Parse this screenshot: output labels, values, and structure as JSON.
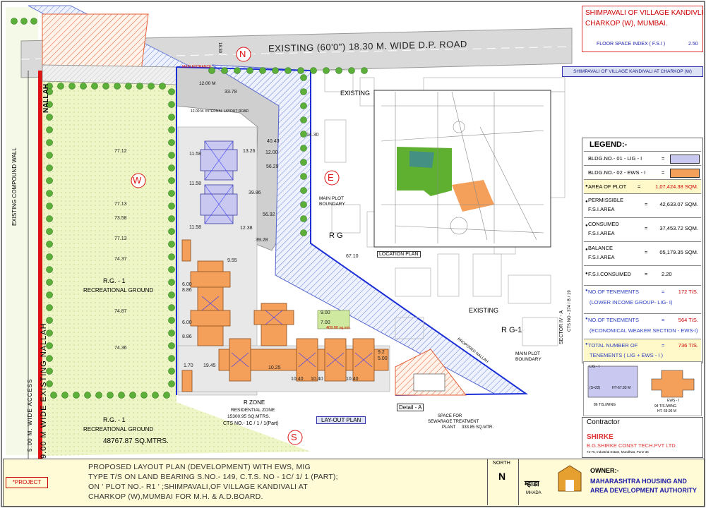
{
  "title_block": {
    "line1": "SHIMPAVALI OF VILLAGE KANDIVLI",
    "line2": "CHARKOP (W), MUMBAI.",
    "fsi_label": "FLOOR SPACE INDEX ( F.S.I )",
    "fsi_value": "2.50"
  },
  "banner_text": "SHIMPAVALI OF VILLAGE KANDIVALI AT CHARKOP (W)",
  "road": {
    "label": "EXISTING (60'0\") 18.30 M. WIDE D.P. ROAD",
    "north_marker": "N",
    "east_marker": "E",
    "west_marker": "W",
    "south_marker": "S"
  },
  "site_labels": {
    "nallah": "NALLAH",
    "compound_wall": "EXISTING COMPOUND WALL",
    "wide_access": "5.00 M. WIDE ACCESS",
    "existing_nallah": "9.00 M WIDE EXISTING NALLAH",
    "rg1_upper": "R.G. - 1",
    "rec_ground_upper": "RECREATIONAL GROUND",
    "rg1_lower": "R.G. - 1",
    "rec_ground_lower": "RECREATIONAL GROUND",
    "rec_ground_area": "48767.87 SQ.MTRS.",
    "main_plot_boundary_1": "MAIN PLOT",
    "main_plot_boundary_2": "BOUNDARY",
    "main_plot_boundary_b1": "MAIN PLOT",
    "main_plot_boundary_b2": "BOUNDARY",
    "rg": "R G",
    "rg1_east": "R G-1",
    "existing_1": "EXISTING",
    "existing_2": "EXISTING",
    "sector": "SECTOR IV - A",
    "cts": "CTS NO - 374 / B / 19",
    "res_zone": "R ZONE",
    "res_zone_title": "RESIDENTIAL ZONE",
    "res_zone_area": "15300.95 SQ.MTRS.",
    "res_zone_cts": "CTS NO.- 1C / 1 / 1(Part)",
    "detail_a": "Detail - A",
    "layout_plan": "LAY-OUT PLAN",
    "stp_1": "SPACE FOR",
    "stp_2": "SEWARAGE TREATMENT",
    "stp_3": "PLANT",
    "stp_area": "333.85 SQ.MTR.",
    "location_plan": "LOCATION PLAN",
    "proposed_nallah": "PROPOSED NALLAH",
    "internal_road": "12.00 M. INTERNAL LAYOUT ROAD",
    "main_entrance": "MAIN ENTRANCE",
    "dim_12": "12.00 M",
    "dim_1830": "18.30",
    "open_space": "409.00 sq.mtr."
  },
  "dimensions": [
    "77.12",
    "77.13",
    "73.58",
    "77.13",
    "74.37",
    "74.87",
    "74.36",
    "40.43",
    "56.29",
    "56.92",
    "67.10",
    "11.58",
    "11.58",
    "11.58",
    "13.26",
    "12.00",
    "39.86",
    "12.38",
    "39.28",
    "9.55",
    "6.00",
    "8.86",
    "6.00",
    "8.86",
    "19.45",
    "10.25",
    "9.00",
    "7.00",
    "9.2",
    "5.00",
    "1.70",
    "10.40",
    "10.40",
    "10.40",
    "14.30",
    "33.78"
  ],
  "legend": {
    "title": "LEGEND:-",
    "bldg1": "BLDG.NO.- 01 - LIG - I",
    "bldg1_color": "#c8c8f0",
    "bldg2": "BLDG.NO.- 02 - EWS - I",
    "bldg2_color": "#f5a05a",
    "eq": "=",
    "area_plot_label": "AREA OF PLOT",
    "area_plot_value": "1,07,424.38 SQM.",
    "permissible_label_1": "PERMISSIBLE",
    "permissible_label_2": "F.S.I.AREA",
    "permissible_value": "42,633.07 SQM.",
    "consumed_label_1": "CONSUMED",
    "consumed_label_2": "F.S.I.AREA",
    "consumed_value": "37,453.72 SQM.",
    "balance_label_1": "BALANCE",
    "balance_label_2": "F.S.I.AREA",
    "balance_value": "05,179.35 SQM.",
    "fsi_consumed_label": "F.S.I.CONSUMED",
    "fsi_consumed_value": "2.20",
    "tenements_lig_label": "NO.OF TENEMENTS",
    "tenements_lig_value": "172 T/S.",
    "tenements_lig_sub": "(LOWER INCOME GROUP- LIG- I)",
    "tenements_ews_label": "NO.OF TENEMENTS",
    "tenements_ews_value": "564 T/S.",
    "tenements_ews_sub": "(ECONOMICAL WEAKER SECTION - EWS-I)",
    "total_label": "TOTAL NUMBER OF",
    "total_value": "736 T/S.",
    "total_sub": "TENEMENTS ( LIG + EWS - I )"
  },
  "typology": {
    "lig_label": "LIG - I",
    "lig_height": "HT-67.93 M",
    "lig_floors": "(S+22)",
    "lig_ts": "86 T/S./WING",
    "ews_label": "EWS - I",
    "ews_ts": "94 T/S./WING",
    "ews_height": "HT. 69.96 M"
  },
  "contractor": {
    "header": "Contractor",
    "logo": "SHIRKE",
    "name": "B.G.SHIRKE CONST TECH.PVT LTD.",
    "address": "72-76, Industrial Estate, Mundhwa, Pune-36"
  },
  "bottom": {
    "project_tag": "*PROJECT",
    "desc_1": "PROPOSED LAYOUT PLAN (DEVELOPMENT) WITH EWS, MIG",
    "desc_2": "TYPE T/S ON LAND BEARING S.NO.- 149, C.T.S. NO - 1C/ 1/ 1 (PART);",
    "desc_3": "ON ' PLOT NO.-  R1 ' ;SHIMPAVALI,OF VILLAGE  KANDIVALI AT",
    "desc_4": "CHARKOP (W),MUMBAI FOR M.H. & A.D.BOARD.",
    "north_label": "NORTH",
    "north_letter": "N",
    "mhada_label": "म्हाडा",
    "mhada_sub": "MHADA",
    "owner_label": "OWNER:-",
    "owner_1": "MAHARASHTRA HOUSING AND",
    "owner_2": "AREA DEVELOPMENT AUTHORITY"
  }
}
